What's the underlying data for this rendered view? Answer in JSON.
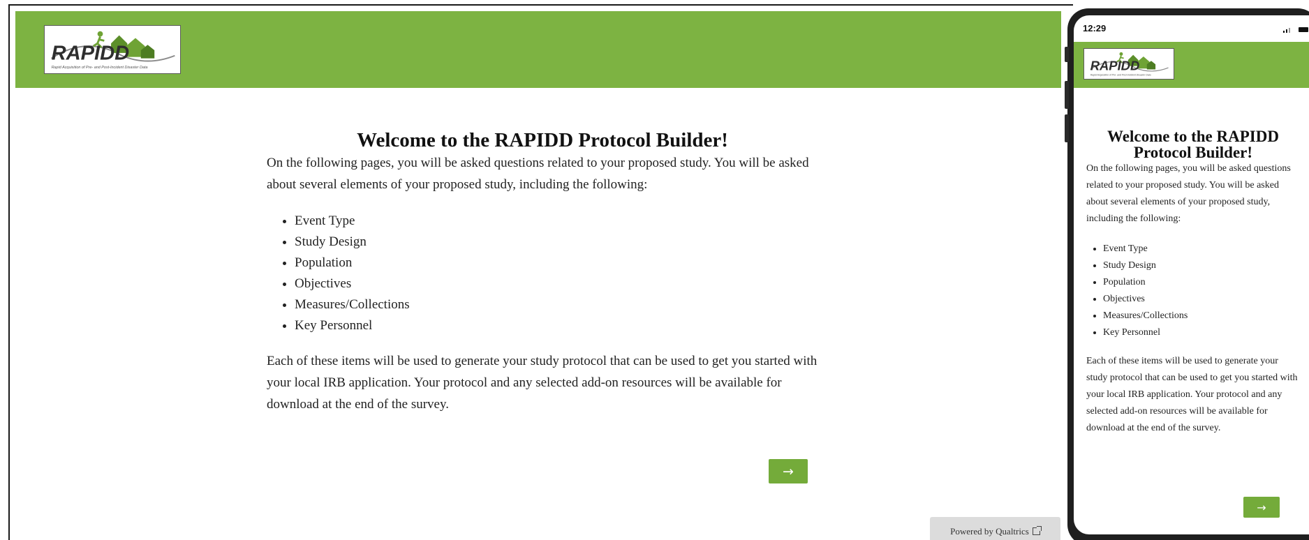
{
  "brand": {
    "logo_text": "RAPIDD",
    "logo_tagline": "Rapid Acquisition of Pre- and Post-Incident Disaster Data",
    "header_color": "#7db342",
    "button_color": "#74ab3a"
  },
  "survey": {
    "title": "Welcome to the RAPIDD Protocol Builder!",
    "intro": "On the following pages, you will be asked questions related to your proposed study. You will be asked about several elements of your proposed study, including the following:",
    "items": [
      "Event Type",
      "Study Design",
      "Population",
      "Objectives",
      "Measures/Collections",
      "Key Personnel"
    ],
    "closing": "Each of these items will be used to generate your study protocol that can be used to get you started with your local IRB application. Your protocol and any selected add-on resources will be available for download at the end of the survey.",
    "next_label": "→",
    "powered_by": "Powered by Qualtrics"
  },
  "phone": {
    "time": "12:29"
  },
  "icons": {
    "next": "arrow-right-icon",
    "external": "external-link-icon",
    "signal": "signal-icon",
    "battery": "battery-icon"
  }
}
